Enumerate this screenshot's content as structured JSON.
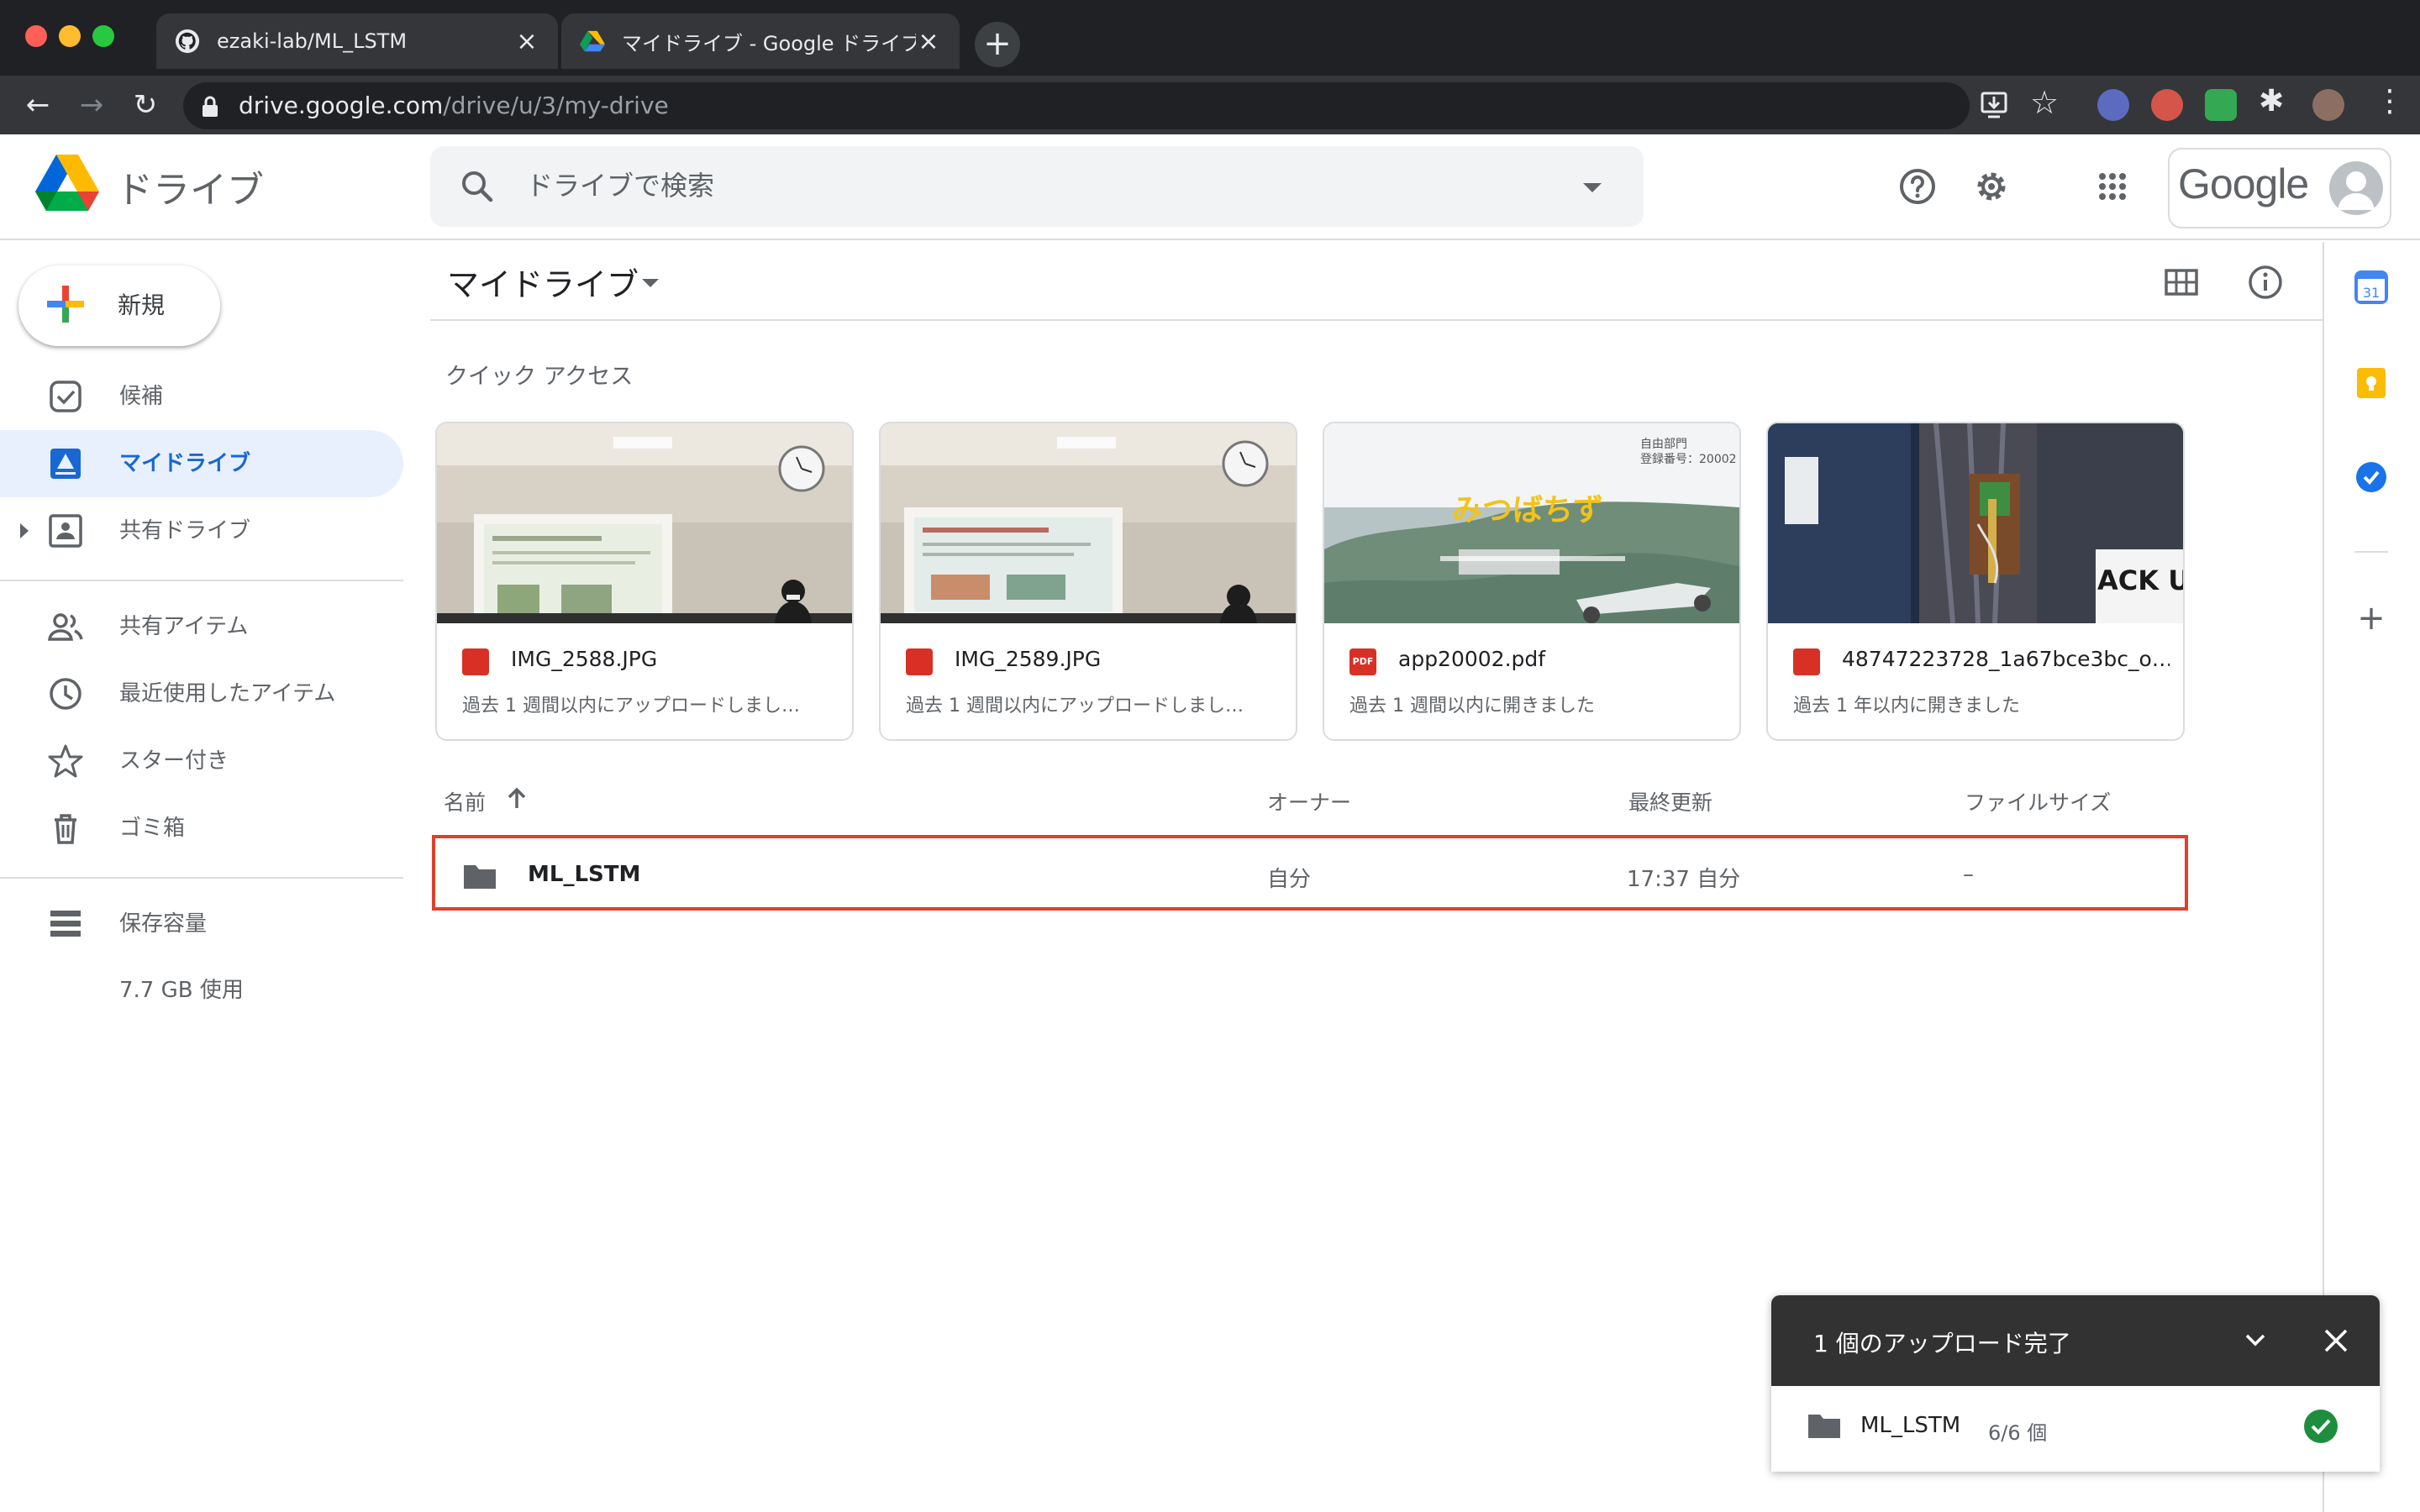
{
  "browser": {
    "tabs": [
      {
        "title": "ezaki-lab/ML_LSTM",
        "icon": "github-icon"
      },
      {
        "title": "マイドライブ - Google ドライブ",
        "icon": "google-drive-icon"
      }
    ],
    "url_host": "drive.google.com",
    "url_path": "/drive/u/3/my-drive"
  },
  "header": {
    "app_title": "ドライブ",
    "search_placeholder": "ドライブで検索",
    "account_brand": "Google"
  },
  "sidebar": {
    "new_label": "新規",
    "items": [
      {
        "label": "候補",
        "icon": "check-box-icon"
      },
      {
        "label": "マイドライブ",
        "icon": "my-drive-icon",
        "active": true
      },
      {
        "label": "共有ドライブ",
        "icon": "shared-drives-icon"
      },
      {
        "label": "共有アイテム",
        "icon": "people-icon"
      },
      {
        "label": "最近使用したアイテム",
        "icon": "clock-icon"
      },
      {
        "label": "スター付き",
        "icon": "star-icon"
      },
      {
        "label": "ゴミ箱",
        "icon": "trash-icon"
      },
      {
        "label": "保存容量",
        "icon": "storage-icon"
      }
    ],
    "storage_used": "7.7 GB 使用"
  },
  "main": {
    "title": "マイドライブ",
    "quick_access_title": "クイック アクセス",
    "quick_access": [
      {
        "name": "IMG_2588.JPG",
        "sub": "過去 1 週間以内にアップロードしまし…",
        "type": "image"
      },
      {
        "name": "IMG_2589.JPG",
        "sub": "過去 1 週間以内にアップロードしまし…",
        "type": "image"
      },
      {
        "name": "app20002.pdf",
        "sub": "過去 1 週間以内に開きました",
        "type": "pdf",
        "thumb_title": "みつばちず",
        "thumb_corner": "自由部門\n登録番号：20002"
      },
      {
        "name": "48747223728_1a67bce3bc_o…",
        "sub": "過去 1 年以内に開きました",
        "type": "image",
        "thumb_text": "ACK U"
      }
    ],
    "columns": {
      "name": "名前",
      "owner": "オーナー",
      "modified": "最終更新",
      "size": "ファイルサイズ"
    },
    "rows": [
      {
        "name": "ML_LSTM",
        "owner": "自分",
        "modified": "17:37 自分",
        "size": "–"
      }
    ]
  },
  "upload": {
    "title": "1 個のアップロード完了",
    "item_name": "ML_LSTM",
    "item_count": "6/6 個"
  },
  "colors": {
    "accent": "#1a73e8",
    "active_bg": "#e8f0fe",
    "selection_border": "#e0402a",
    "success": "#1e8e3e"
  }
}
